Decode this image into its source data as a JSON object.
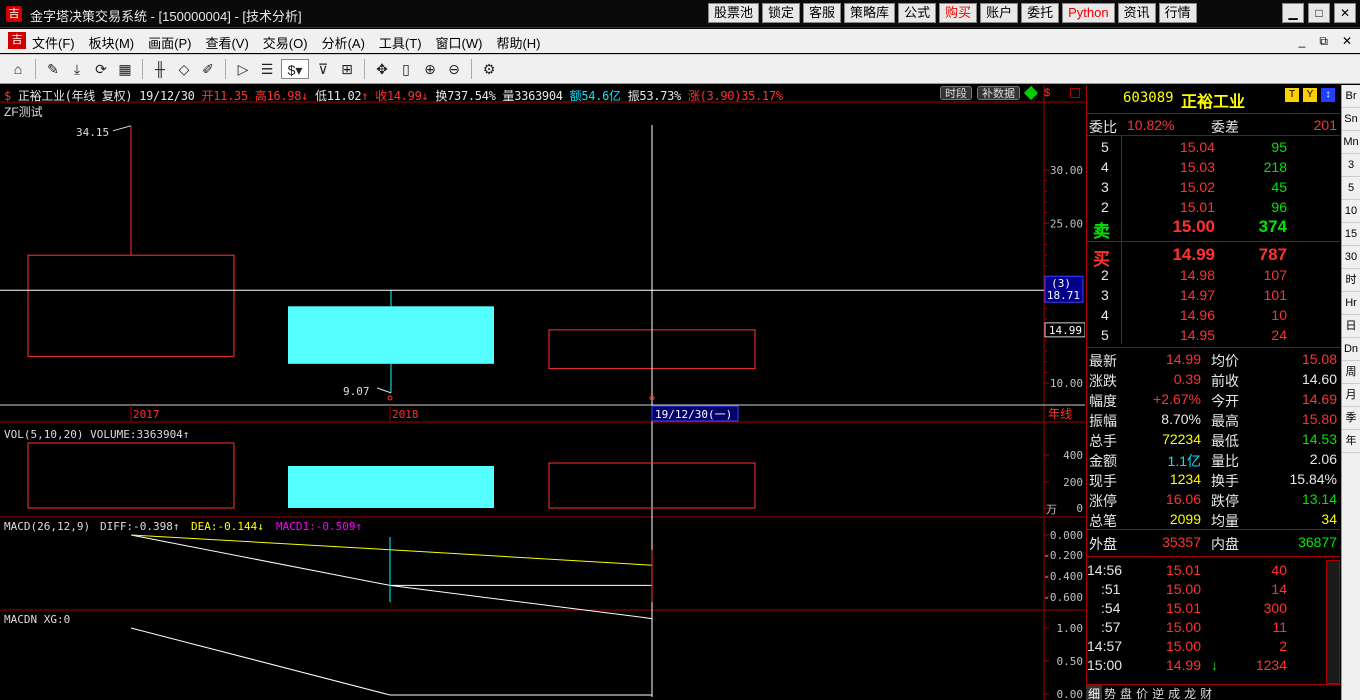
{
  "window": {
    "title": "金字塔决策交易系统 - [150000004] - [技术分析]",
    "app_icon": "吉",
    "top_buttons": [
      "股票池",
      "锁定",
      "客服",
      "策略库",
      "公式",
      "购买",
      "账户",
      "委托",
      "Python",
      "资讯",
      "行情"
    ],
    "controls": [
      "▁",
      "□",
      "✕"
    ]
  },
  "menu": {
    "logo": "吉",
    "items": [
      "文件(F)",
      "板块(M)",
      "画面(P)",
      "查看(V)",
      "交易(O)",
      "分析(A)",
      "工具(T)",
      "窗口(W)",
      "帮助(H)"
    ],
    "right": [
      "_",
      "⧉",
      "✕"
    ]
  },
  "toolbar": {
    "icons": [
      "home-icon",
      "ruler-icon",
      "download-icon",
      "refresh-icon",
      "grid-icon",
      "candles-icon",
      "diamond-icon",
      "pen-icon",
      "play-icon",
      "list-icon",
      "dollar-icon",
      "filter-icon",
      "chart-icon",
      "move-icon",
      "column-icon",
      "zoom-in-icon",
      "zoom-out-icon",
      "settings-icon"
    ]
  },
  "chart": {
    "info": {
      "dollar": "$",
      "name": "正裕工业(年线 复权)",
      "date": "19/12/30",
      "open": "开11.35",
      "high": "高16.98",
      "low": "低11.02",
      "close": "收14.99",
      "turnover": "换737.54%",
      "volume": "量3363904",
      "amount": "额54.6亿",
      "amplitude": "振53.73%",
      "change": "涨(3.90)35.17%"
    },
    "chip_period": "时段",
    "chip_data": "补数据",
    "indicator_main": "ZF测试",
    "label_high": "34.15",
    "label_low": "9.07",
    "price_ticks": [
      "30.00",
      "25.00",
      "10.00"
    ],
    "current_price": "14.99",
    "cursor_tag_top": "(3)",
    "cursor_tag_bottom": "18.71",
    "years": [
      "2017",
      "2018"
    ],
    "cursor_date": "19/12/30(一)",
    "period_label": "年线",
    "vol_title": "VOL(5,10,20)",
    "vol_value": "VOLUME:3363904",
    "vol_ticks": [
      "400",
      "200",
      "0"
    ],
    "vol_unit": "万",
    "macd_title": "MACD(26,12,9)",
    "macd_diff": "DIFF:-0.398",
    "macd_dea": "DEA:-0.144",
    "macd_macd1": "MACD1:-0.509",
    "macd_ticks": [
      "0.000",
      "-0.200",
      "-0.400",
      "-0.600"
    ],
    "macdn_title": "MACDN XG:0",
    "macdn_ticks": [
      "1.00",
      "0.50",
      "0.00"
    ]
  },
  "chart_data": {
    "type": "candlestick",
    "categories": [
      "2017",
      "2018",
      "2019"
    ],
    "ohlc": [
      {
        "open": 22.0,
        "high": 34.15,
        "low": 12.5,
        "close": 12.5,
        "color": "red"
      },
      {
        "open": 17.2,
        "high": 18.71,
        "low": 9.07,
        "close": 11.8,
        "color": "cyan"
      },
      {
        "open": 11.35,
        "high": 16.98,
        "low": 11.02,
        "close": 14.99,
        "color": "red"
      }
    ],
    "volume": [
      3300000,
      3000000,
      3363904
    ],
    "macd_diff": [
      0.0,
      -0.24,
      -0.398
    ],
    "macd_dea": [
      0.0,
      -0.07,
      -0.144
    ],
    "macdn_xg": [
      1.0,
      0.0,
      0.0
    ],
    "ylim": [
      8,
      35
    ]
  },
  "quote": {
    "code": "603089",
    "name": "正裕工业",
    "icons": [
      "T",
      "Y",
      "↕"
    ],
    "weibi_label": "委比",
    "weibi": "10.82%",
    "weicha_label": "委差",
    "weicha": "201",
    "asks": [
      {
        "level": "5",
        "price": "15.04",
        "vol": "95"
      },
      {
        "level": "4",
        "price": "15.03",
        "vol": "218"
      },
      {
        "level": "3",
        "price": "15.02",
        "vol": "45"
      },
      {
        "level": "2",
        "price": "15.01",
        "vol": "96"
      },
      {
        "level": "卖",
        "price": "15.00",
        "vol": "374"
      }
    ],
    "bids": [
      {
        "level": "买",
        "price": "14.99",
        "vol": "787"
      },
      {
        "level": "2",
        "price": "14.98",
        "vol": "107"
      },
      {
        "level": "3",
        "price": "14.97",
        "vol": "101"
      },
      {
        "level": "4",
        "price": "14.96",
        "vol": "10"
      },
      {
        "level": "5",
        "price": "14.95",
        "vol": "24"
      }
    ],
    "stats": [
      {
        "l1": "最新",
        "v1": "14.99",
        "c1": "red",
        "l2": "均价",
        "v2": "15.08",
        "c2": "red"
      },
      {
        "l1": "涨跌",
        "v1": "0.39",
        "c1": "red",
        "l2": "前收",
        "v2": "14.60",
        "c2": "white"
      },
      {
        "l1": "幅度",
        "v1": "+2.67%",
        "c1": "red",
        "l2": "今开",
        "v2": "14.69",
        "c2": "red"
      },
      {
        "l1": "振幅",
        "v1": "8.70%",
        "c1": "white",
        "l2": "最高",
        "v2": "15.80",
        "c2": "red"
      },
      {
        "l1": "总手",
        "v1": "72234",
        "c1": "yellow",
        "l2": "最低",
        "v2": "14.53",
        "c2": "green"
      },
      {
        "l1": "金额",
        "v1": "1.1亿",
        "c1": "cyan",
        "l2": "量比",
        "v2": "2.06",
        "c2": "white"
      },
      {
        "l1": "现手",
        "v1": "1234",
        "c1": "yellow",
        "l2": "换手",
        "v2": "15.84%",
        "c2": "white"
      },
      {
        "l1": "涨停",
        "v1": "16.06",
        "c1": "red",
        "l2": "跌停",
        "v2": "13.14",
        "c2": "green"
      },
      {
        "l1": "总笔",
        "v1": "2099",
        "c1": "yellow",
        "l2": "均量",
        "v2": "34",
        "c2": "yellow"
      }
    ],
    "outer_label": "外盘",
    "outer": "35357",
    "inner_label": "内盘",
    "inner": "36877",
    "ticks": [
      {
        "time": "14:56",
        "price": "15.01",
        "vol": "40",
        "arrow": ""
      },
      {
        "time": ":51",
        "price": "15.00",
        "vol": "14",
        "arrow": ""
      },
      {
        "time": ":54",
        "price": "15.01",
        "vol": "300",
        "arrow": ""
      },
      {
        "time": ":57",
        "price": "15.00",
        "vol": "11",
        "arrow": ""
      },
      {
        "time": "14:57",
        "price": "15.00",
        "vol": "2",
        "arrow": ""
      },
      {
        "time": "15:00",
        "price": "14.99",
        "vol": "1234",
        "arrow": "↓"
      }
    ],
    "bottom_tabs": [
      "细",
      "势",
      "盘",
      "价",
      "逆",
      "成",
      "龙",
      "财"
    ]
  },
  "right_strip": [
    "Br",
    "Sn",
    "Mn",
    "3",
    "5",
    "10",
    "15",
    "30",
    "时",
    "Hr",
    "日",
    "Dn",
    "周",
    "月",
    "季",
    "年"
  ],
  "colors": {
    "up": "#ff3232",
    "down": "#00e5ff",
    "axis": "#a00000",
    "text": "#c0c0c0"
  }
}
